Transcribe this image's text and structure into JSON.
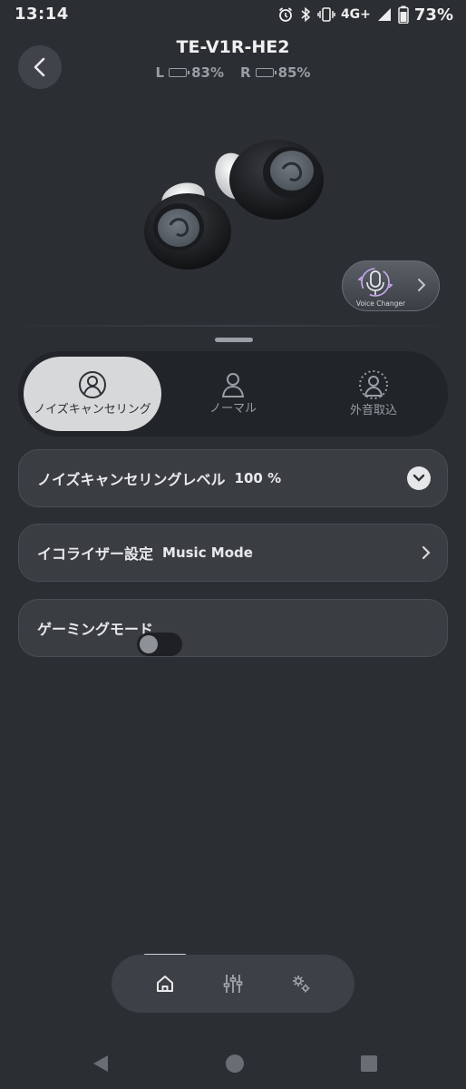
{
  "status_bar": {
    "time": "13:14",
    "network": "4G+",
    "battery": "73%",
    "icons": [
      "alarm-icon",
      "bluetooth-icon",
      "vibrate-icon",
      "signal-icon",
      "battery-icon"
    ]
  },
  "header": {
    "device_name": "TE-V1R-HE2",
    "left_label": "L",
    "left_battery": "83%",
    "left_battery_level": 0.83,
    "right_label": "R",
    "right_battery": "85%",
    "right_battery_level": 0.85,
    "battery_color": "#35c24a"
  },
  "voice_changer": {
    "label": "Voice Changer"
  },
  "modes": {
    "items": [
      {
        "label": "ノイズキャンセリング",
        "icon": "noise-cancel-person-icon",
        "active": true
      },
      {
        "label": "ノーマル",
        "icon": "person-icon",
        "active": false
      },
      {
        "label": "外音取込",
        "icon": "ambient-person-icon",
        "active": false
      }
    ]
  },
  "settings": {
    "noise_level_label": "ノイズキャンセリングレベル",
    "noise_level_value": "100 %",
    "eq_label": "イコライザー設定",
    "eq_value": "Music Mode",
    "gaming_label": "ゲーミングモード",
    "gaming_enabled": false
  },
  "bottom_nav": {
    "items": [
      "home-icon",
      "equalizer-sliders-icon",
      "settings-gears-icon"
    ],
    "active": "home-icon"
  },
  "system_nav": [
    "back-triangle-icon",
    "home-circle-icon",
    "recents-square-icon"
  ]
}
